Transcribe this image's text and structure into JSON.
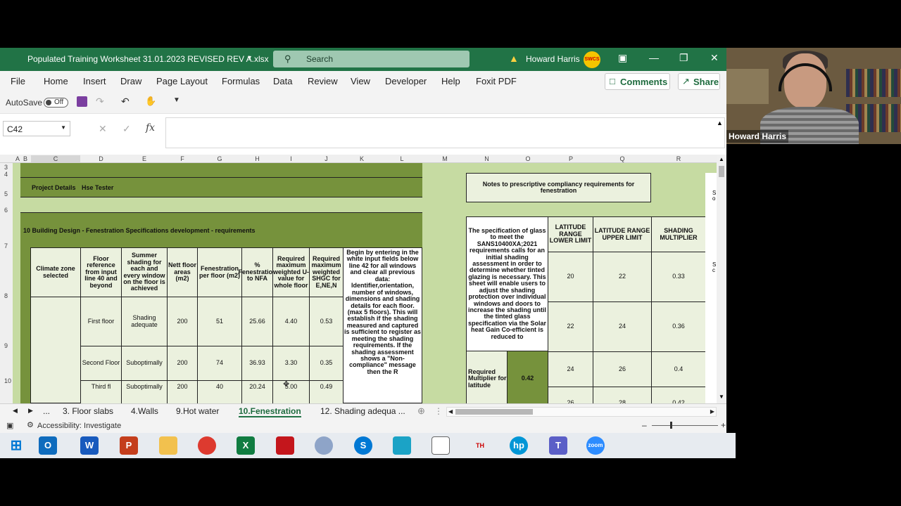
{
  "titlebar": {
    "doc_title": "Populated Training Worksheet 31.01.2023 REVISED REV A.xlsx",
    "search_placeholder": "Search",
    "user_name": "Howard Harris",
    "avatar_text": "SWCS"
  },
  "ribbon": {
    "tabs": [
      "File",
      "Home",
      "Insert",
      "Draw",
      "Page Layout",
      "Formulas",
      "Data",
      "Review",
      "View",
      "Developer",
      "Help",
      "Foxit PDF"
    ],
    "comments": "Comments",
    "share": "Share"
  },
  "qat": {
    "autosave": "AutoSave",
    "autosave_state": "Off"
  },
  "formula_bar": {
    "name_box": "C42",
    "fx": "fx",
    "content": ""
  },
  "columns": [
    "A",
    "B",
    "C",
    "D",
    "E",
    "F",
    "G",
    "H",
    "I",
    "J",
    "K",
    "L",
    "M",
    "N",
    "O",
    "P",
    "Q",
    "R"
  ],
  "rows": [
    "3",
    "4",
    "5",
    "6",
    "7",
    "8",
    "9",
    "10"
  ],
  "sheet": {
    "project_label": "Project Details",
    "project_value": "Hse Tester",
    "section_title": "10 Building Design - Fenestration Specifications development - requirements",
    "headers": {
      "climate": "Climate zone selected",
      "floor_ref": "Floor reference from input line 40 and beyond",
      "summer": "Summer shading for each and every window on the floor is achieved",
      "nett": "Nett floor areas (m2)",
      "fen_floor": "Fenestration per floor (m2)",
      "pct": "% Fenestration to NFA",
      "req_u": "Required maximum weighted U-value for whole floor",
      "req_shgc": "Required maximum weighted SHGC for E,NE,N"
    },
    "instructions": "Begin by entering in the white input fields below line 42 for all windows and clear all previous data: Identifier,orientation, number of windows, dimensions and shading details for each floor. (max 5 floors). This will establish if the shading measured and captured is sufficient to register as meeting the shading requirements. If the shading assessment shows a \"Non-compliance\" message then the R",
    "rows": [
      {
        "floor": "First floor",
        "summer": "Shading adequate",
        "nett": "200",
        "fen": "51",
        "pct": "25.66",
        "u": "4.40",
        "shgc": "0.53"
      },
      {
        "floor": "Second Floor",
        "summer": "Suboptimally",
        "nett": "200",
        "fen": "74",
        "pct": "36.93",
        "u": "3.30",
        "shgc": "0.35"
      },
      {
        "floor": "Third fl",
        "summer": "Suboptimally",
        "nett": "200",
        "fen": "40",
        "pct": "20.24",
        "u": "5.00",
        "shgc": "0.49"
      }
    ],
    "notes_title": "Notes to prescriptive compliancy requirements for fenestration",
    "notes_text": "The specification of glass to meet the SANS10400XA;2021 requirements calls for an initial shading assessment in order to determine whether tinted glazing is necessary. This sheet will enable users to adjust the shading protection over individual windows and doors to increase the shading until the tinted glass specification via the Solar heat Gain Co-efficient is reduced to",
    "lat_headers": {
      "lower": "LATITUDE RANGE LOWER LIMIT",
      "upper": "LATITUDE RANGE UPPER LIMIT",
      "mult": "SHADING MULTIPLIER"
    },
    "lat_rows": [
      {
        "lower": "20",
        "upper": "22",
        "mult": "0.33"
      },
      {
        "lower": "22",
        "upper": "24",
        "mult": "0.36"
      },
      {
        "lower": "24",
        "upper": "26",
        "mult": "0.4"
      },
      {
        "lower": "26",
        "upper": "28",
        "mult": "0.42"
      }
    ],
    "req_mult_label": "Required Multiplier for latitude",
    "req_mult_value": "0.42",
    "edge_s1": "S",
    "edge_o1": "o",
    "edge_s2": "S",
    "edge_c2": "c"
  },
  "sheet_tabs": [
    "...",
    "3. Floor slabs",
    "4.Walls",
    "9.Hot water",
    "10.Fenestration",
    "12. Shading adequa ..."
  ],
  "status": {
    "accessibility": "Accessibility: Investigate"
  },
  "webcam": {
    "name": "Howard Harris"
  },
  "taskbar_apps": [
    "windows-start",
    "outlook",
    "word",
    "powerpoint",
    "file-explorer",
    "chrome",
    "excel",
    "pdf-editor",
    "paint",
    "skype",
    "snipping",
    "notepad",
    "thermal",
    "hp",
    "teams",
    "zoom"
  ]
}
